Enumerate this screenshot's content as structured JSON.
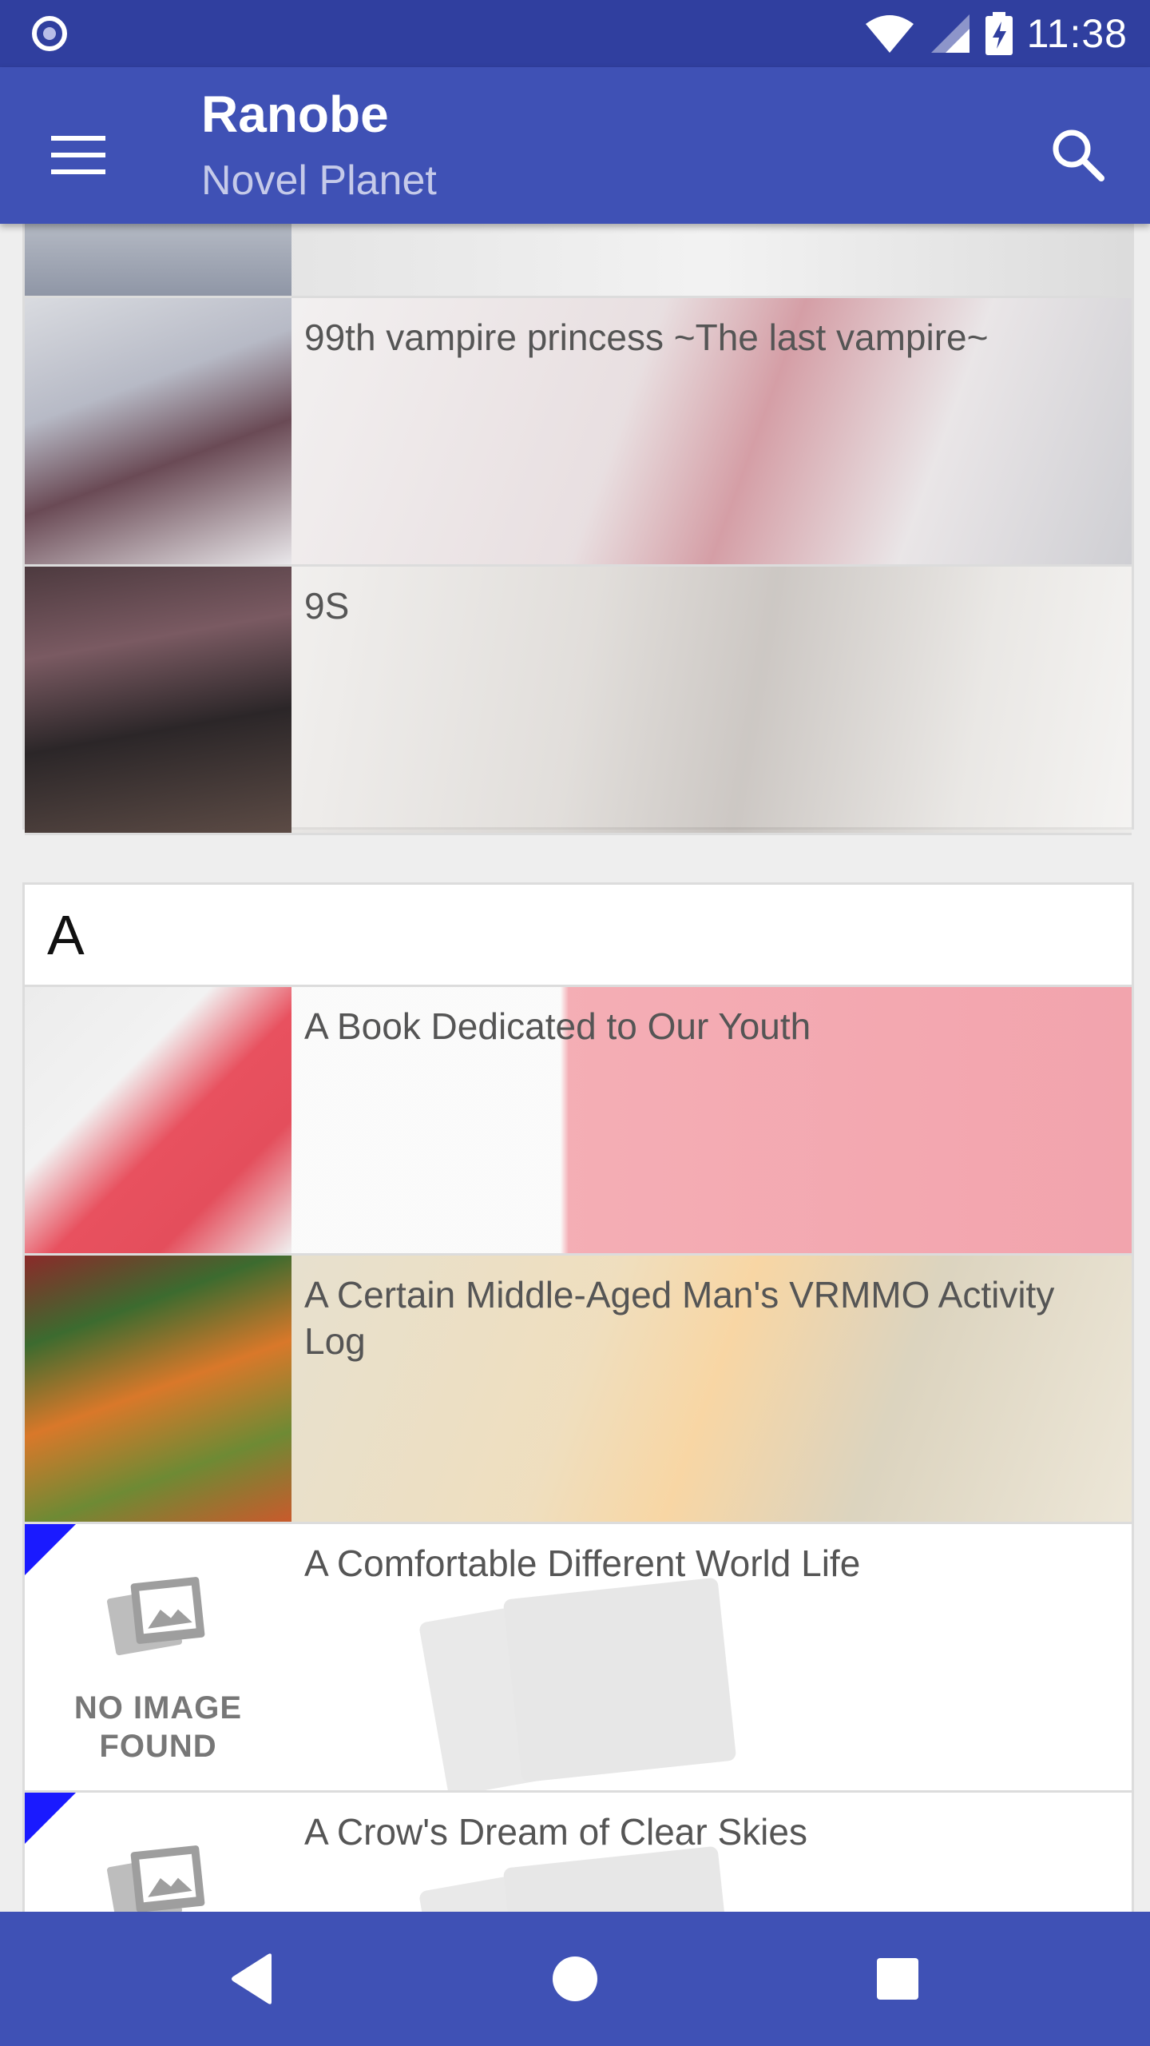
{
  "status_bar": {
    "time": "11:38"
  },
  "app_bar": {
    "title": "Ranobe",
    "subtitle": "Novel Planet"
  },
  "list": {
    "top_card_items": [
      {
        "title": "99th vampire princess ~The last vampire~"
      },
      {
        "title": "9S"
      }
    ],
    "section_a": {
      "header": "A",
      "items": [
        {
          "title": "A Book Dedicated to Our Youth"
        },
        {
          "title": "A Certain Middle-Aged Man's VRMMO Activity Log"
        },
        {
          "title": "A Comfortable Different World Life",
          "placeholder_line1": "NO IMAGE",
          "placeholder_line2": "FOUND"
        },
        {
          "title": "A Crow's Dream of Clear Skies"
        }
      ]
    }
  },
  "colors": {
    "status_bar": "#303f9f",
    "app_bar": "#3f51b5",
    "nav_bar": "#3f51b5",
    "corner_badge": "#1a1aff"
  }
}
